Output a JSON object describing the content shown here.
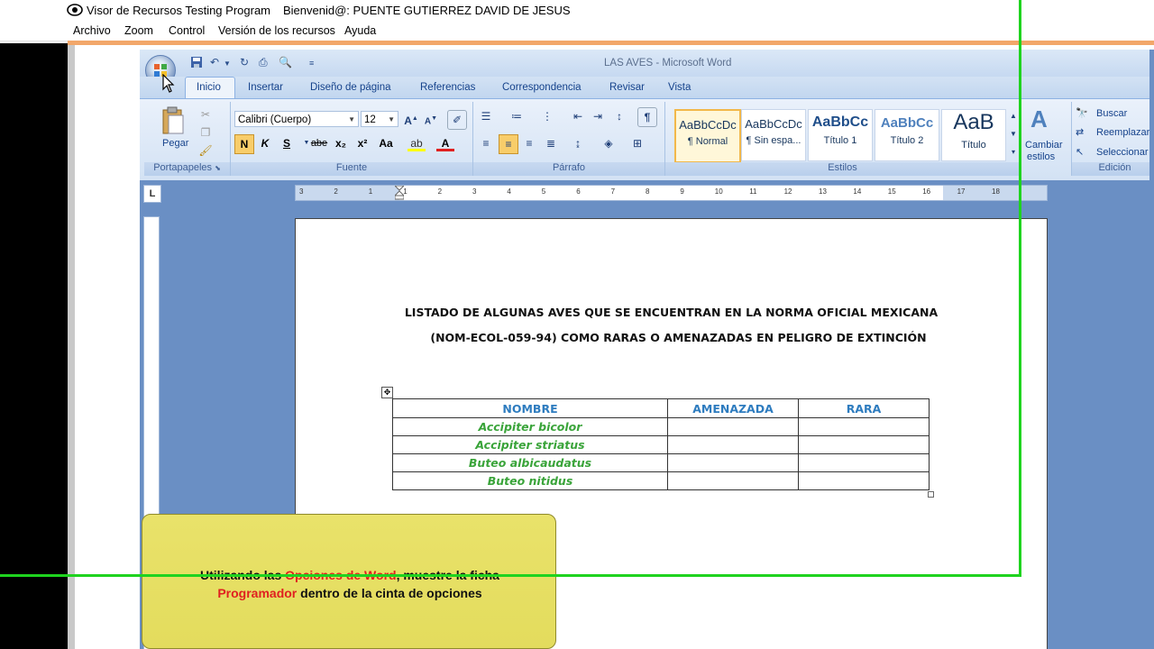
{
  "host_app": {
    "title": "Visor de Recursos Testing Program",
    "welcome": "Bienvenid@: PUENTE GUTIERREZ DAVID DE JESUS",
    "menu": [
      "Archivo",
      "Zoom",
      "Control",
      "Versión de los recursos",
      "Ayuda"
    ]
  },
  "word": {
    "window_title": "LAS AVES - Microsoft Word",
    "tabs": [
      "Inicio",
      "Insertar",
      "Diseño de página",
      "Referencias",
      "Correspondencia",
      "Revisar",
      "Vista"
    ],
    "active_tab": "Inicio",
    "clipboard": {
      "paste_label": "Pegar",
      "group_label": "Portapapeles"
    },
    "font": {
      "name": "Calibri (Cuerpo)",
      "size": "12",
      "bold": "N",
      "italic": "K",
      "underline": "S",
      "strike": "abe",
      "subscript": "x₂",
      "superscript": "x²",
      "case": "Aa",
      "group_label": "Fuente"
    },
    "paragraph": {
      "group_label": "Párrafo",
      "pilcrow": "¶"
    },
    "styles": {
      "items": [
        {
          "preview": "AaBbCcDc",
          "name": "¶ Normal"
        },
        {
          "preview": "AaBbCcDc",
          "name": "¶ Sin espa..."
        },
        {
          "preview": "AaBbCc",
          "name": "Título 1"
        },
        {
          "preview": "AaBbCc",
          "name": "Título 2"
        },
        {
          "preview": "AaB",
          "name": "Título"
        }
      ],
      "change_label_1": "Cambiar",
      "change_label_2": "estilos",
      "group_label": "Estilos"
    },
    "editing": {
      "find": "Buscar",
      "replace": "Reemplazar",
      "select": "Seleccionar",
      "group_label": "Edición"
    },
    "ruler_numbers": [
      "3",
      "2",
      "1",
      "1",
      "2",
      "3",
      "4",
      "5",
      "6",
      "7",
      "8",
      "9",
      "10",
      "11",
      "12",
      "13",
      "14",
      "15",
      "16",
      "17",
      "18"
    ],
    "ruler_tab_symbol": "L"
  },
  "document": {
    "heading_line1": "LISTADO DE ALGUNAS AVES QUE SE ENCUENTRAN EN LA NORMA OFICIAL MEXICANA",
    "heading_line2": "(NOM-ECOL-059-94) COMO RARAS O AMENAZADAS EN PELIGRO DE EXTINCIÓN",
    "table": {
      "headers": [
        "NOMBRE",
        "AMENAZADA",
        "RARA"
      ],
      "rows": [
        [
          "Accipiter bicolor",
          "",
          ""
        ],
        [
          "Accipiter striatus",
          "",
          ""
        ],
        [
          "Buteo albicaudatus",
          "",
          ""
        ],
        [
          "Buteo nitidus",
          "",
          ""
        ]
      ]
    }
  },
  "instruction": {
    "part1": "Utilizando las ",
    "highlight1": "Opciones de Word",
    "part2": ", muestre la ficha ",
    "highlight2": "Programador",
    "part3": " dentro de la cinta de opciones"
  },
  "colors": {
    "header_blue": "#2e7cbf",
    "species_green": "#3aa43a",
    "highlight_red": "#e02020",
    "frame_green": "#1fd31f",
    "tooltip_yellow": "#e6df63"
  }
}
